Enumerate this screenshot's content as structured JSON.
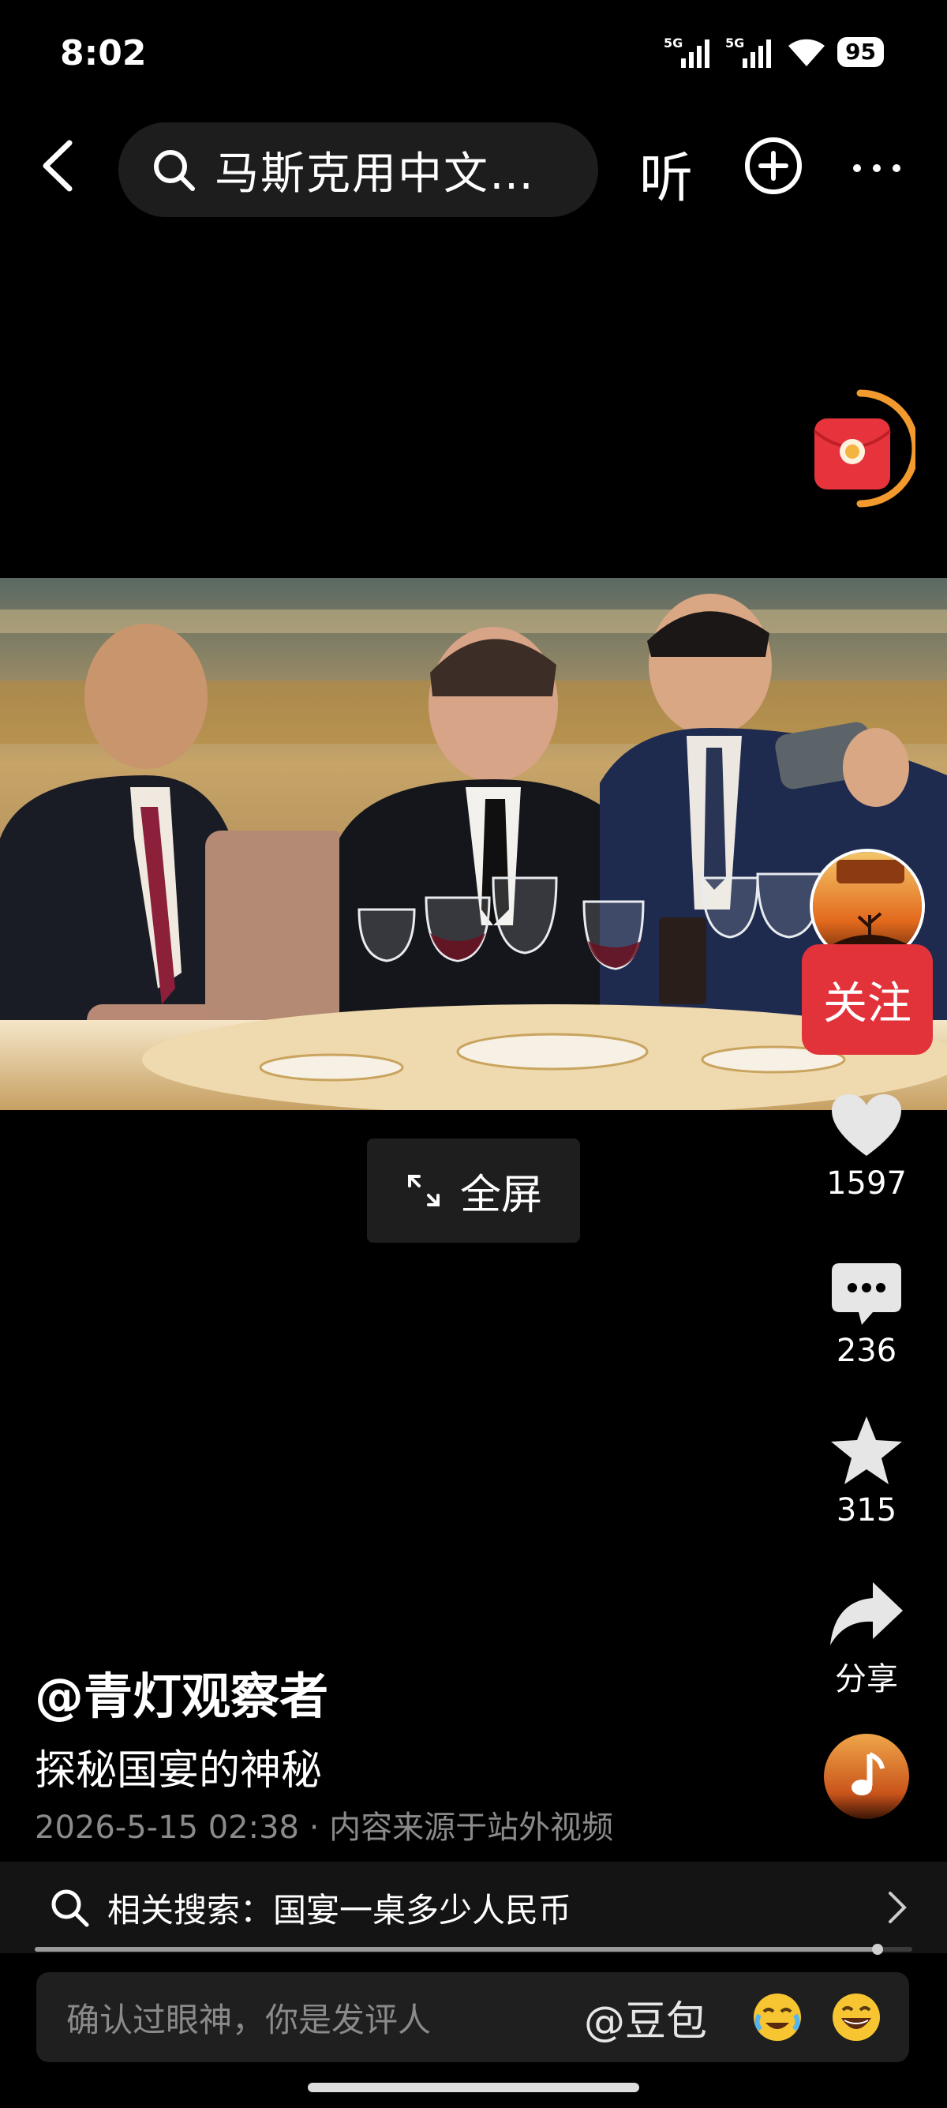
{
  "status_bar": {
    "time": "8:02",
    "battery": "95",
    "signal1": "5G",
    "signal2": "5G"
  },
  "top_nav": {
    "search_text": "马斯克用中文…",
    "listen_label": "听"
  },
  "video": {
    "fullscreen_label": "全屏"
  },
  "right_rail": {
    "follow_label": "关注",
    "likes": "1597",
    "comments": "236",
    "favorites": "315",
    "share_label": "分享"
  },
  "post": {
    "author": "@青灯观察者",
    "caption": "探秘国宴的神秘",
    "meta": "2026-5-15 02:38 · 内容来源于站外视频"
  },
  "related_search": {
    "label": "相关搜索：国宴一桌多少人民币"
  },
  "progress": {
    "fraction": 0.96
  },
  "comment_bar": {
    "placeholder": "确认过眼神，你是发评人",
    "mention": "@豆包"
  },
  "colors": {
    "accent_red": "#e2333b",
    "bg": "#000000"
  }
}
